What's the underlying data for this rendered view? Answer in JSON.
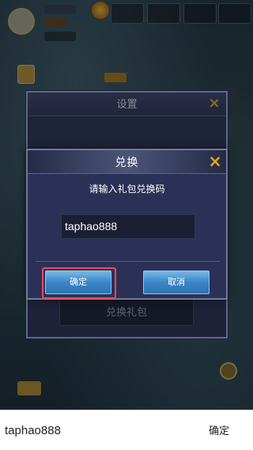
{
  "hud": {
    "player_tag": "",
    "player_level": "",
    "power": "",
    "resources": [
      {
        "label": "",
        "value": ""
      },
      {
        "label": "",
        "value": ""
      },
      {
        "label": "",
        "value": ""
      },
      {
        "label": "",
        "value": ""
      }
    ]
  },
  "settings": {
    "title": "设置",
    "close_icon": "×",
    "redeem_gift_label": "兑换礼包"
  },
  "redeem": {
    "title": "兑换",
    "close_icon": "×",
    "prompt": "请输入礼包兑换码",
    "code_value": "taphao888",
    "confirm_label": "确定",
    "cancel_label": "取消"
  },
  "native_input": {
    "text": "taphao888",
    "confirm_label": "确定"
  },
  "colors": {
    "accent_close": "#e0a21e",
    "button_blue": "#3a86c6",
    "highlight_red": "#ec4a5a",
    "dialog_bg": "#2b3156"
  },
  "icons": {
    "settings_close": "close-icon",
    "redeem_close": "close-icon"
  }
}
